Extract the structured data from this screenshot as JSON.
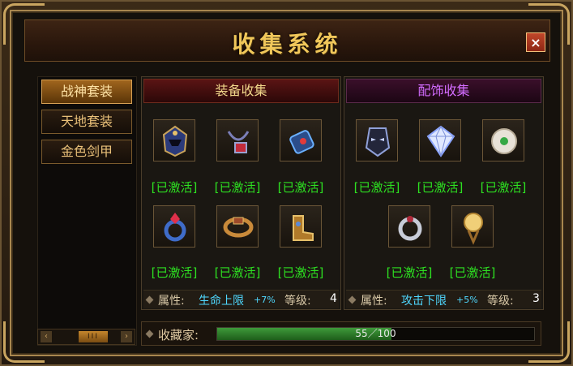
{
  "window": {
    "title": "收集系统",
    "close_label": "×"
  },
  "sidebar": {
    "items": [
      {
        "label": "战神套装",
        "active": true
      },
      {
        "label": "天地套装",
        "active": false
      },
      {
        "label": "金色剑甲",
        "active": false
      }
    ],
    "scroll": {
      "left": "‹",
      "right": "›",
      "thumb": "III"
    }
  },
  "equip_panel": {
    "title": "装备收集",
    "title_color": "#f0d68a",
    "items": [
      {
        "icon": "helmet-icon",
        "status": "[已激活]"
      },
      {
        "icon": "necklace-icon",
        "status": "[已激活]"
      },
      {
        "icon": "bracer-icon",
        "status": "[已激活]"
      },
      {
        "icon": "ring-icon",
        "status": "[已激活]"
      },
      {
        "icon": "belt-icon",
        "status": "[已激活]"
      },
      {
        "icon": "boots-icon",
        "status": "[已激活]"
      }
    ],
    "attr_label": "属性:",
    "attr_name": "生命上限",
    "attr_value": "+7%",
    "level_label": "等级:",
    "level_value": "4"
  },
  "accessory_panel": {
    "title": "配饰收集",
    "title_color": "#d36cff",
    "items": [
      {
        "icon": "mask-icon",
        "status": "[已激活]"
      },
      {
        "icon": "gem-icon",
        "status": "[已激活]"
      },
      {
        "icon": "pearl-icon",
        "status": "[已激活]"
      },
      {
        "icon": "silver-ring-icon",
        "status": "[已激活]"
      },
      {
        "icon": "golden-orb-icon",
        "status": "[已激活]"
      }
    ],
    "attr_label": "属性:",
    "attr_name": "攻击下限",
    "attr_value": "+5%",
    "level_label": "等级:",
    "level_value": "3"
  },
  "collector": {
    "label": "收藏家:",
    "progress_text": "55／100",
    "progress": 0.55
  },
  "colors": {
    "active_green": "#2de021",
    "attr_cyan": "#4fd8ff",
    "gold": "#f0c75a"
  }
}
